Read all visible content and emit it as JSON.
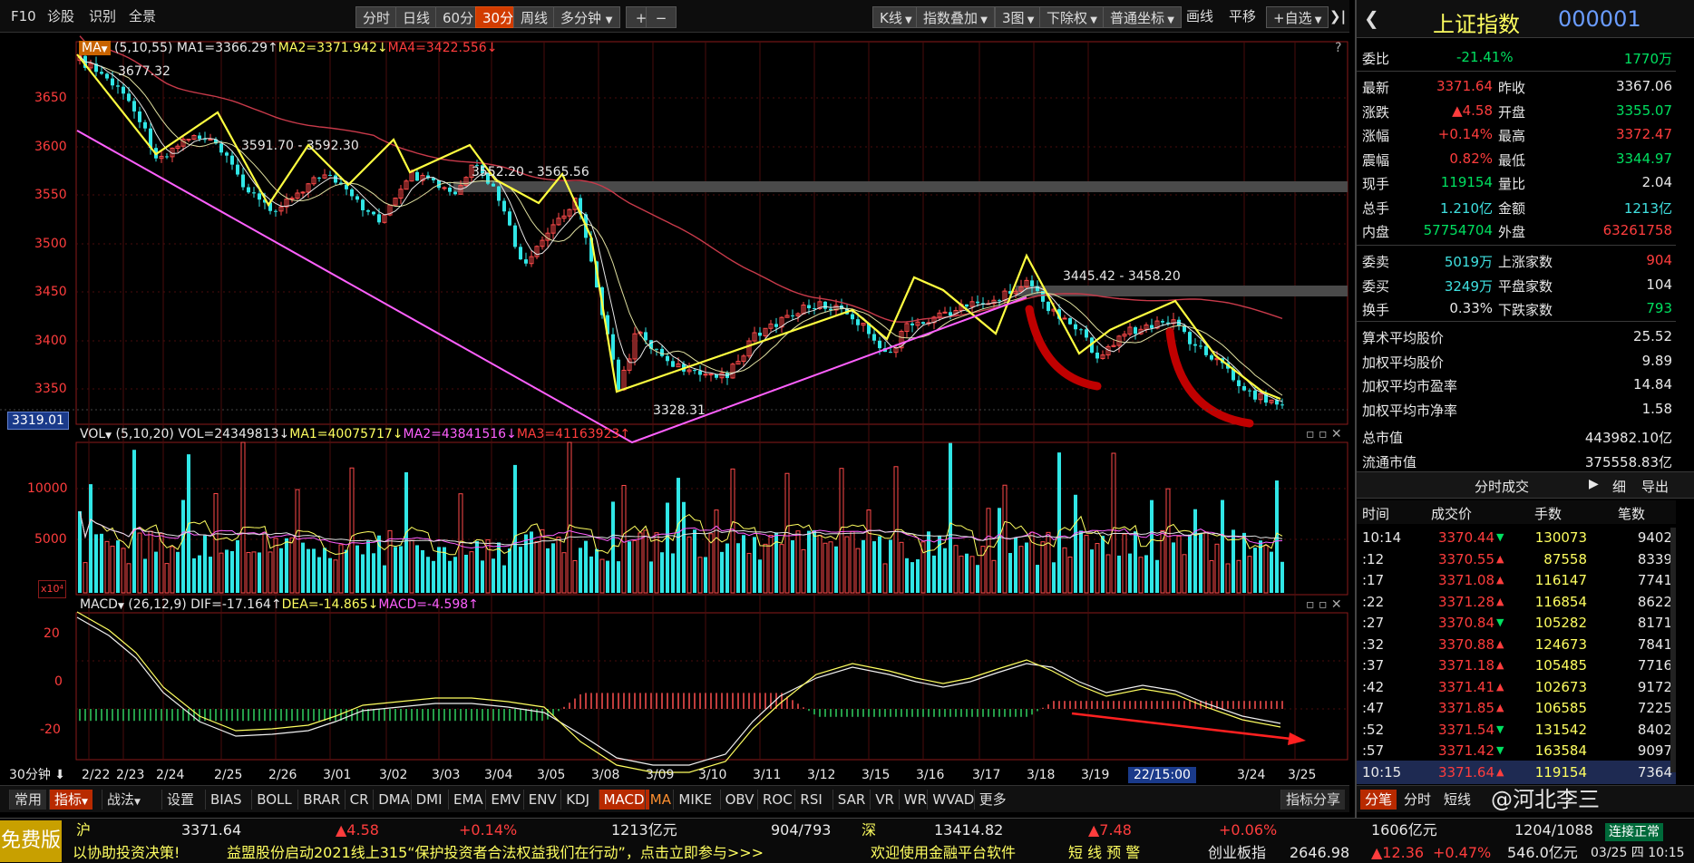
{
  "toolbar": {
    "left_items": [
      "F10",
      "诊股",
      "识别",
      "全景"
    ],
    "periods": [
      "分时",
      "日线",
      "60分",
      "30分",
      "周线"
    ],
    "multi": "多分钟",
    "plus": "+",
    "minus": "−",
    "right": [
      "K线",
      "指数叠加",
      "3图",
      "下除权",
      "普通坐标"
    ],
    "draw": "画线",
    "pan": "平移",
    "watch": "+自选",
    "expand": "❯|"
  },
  "main_panel": {
    "indicator": "MA",
    "params": "(5,10,55)",
    "ma1": "MA1=3366.29↑",
    "ma2": "MA2=3371.942↓",
    "ma4": "MA4=3422.556↓",
    "y_labels": [
      "3650",
      "3600",
      "3550",
      "3500",
      "3450",
      "3400",
      "3350"
    ],
    "cursor_price": "3319.01",
    "annotations": [
      "3677.32",
      "3591.70 - 3592.30",
      "3552.20 - 3565.56",
      "3445.42 - 3458.20",
      "3328.31"
    ],
    "help": "?"
  },
  "vol_panel": {
    "indicator": "VOL",
    "params": "(5,10,20)",
    "vol": "VOL=24349813↓",
    "ma1": "MA1=40075717↓",
    "ma2": "MA2=43841516↓",
    "ma3": "MA3=41163923↑",
    "y_labels": [
      "10000",
      "5000"
    ],
    "unit": "x10⁴"
  },
  "macd_panel": {
    "indicator": "MACD",
    "params": "(26,12,9)",
    "dif": "DIF=-17.164↑",
    "dea": "DEA=-14.865↓",
    "macd": "MACD=-4.598↑",
    "y_labels": [
      "20",
      "0",
      "-20"
    ]
  },
  "x_axis": {
    "period_label": "30分钟",
    "dates": [
      "2/22",
      "2/23",
      "2/24",
      "2/25",
      "2/26",
      "3/01",
      "3/02",
      "3/03",
      "3/04",
      "3/05",
      "3/08",
      "3/09",
      "3/10",
      "3/11",
      "3/12",
      "3/15",
      "3/16",
      "3/17",
      "3/18",
      "3/19",
      "3/24",
      "3/25"
    ],
    "cursor_time": "22/15:00"
  },
  "bottom_tabs": {
    "left": [
      "常用",
      "指标",
      "战法",
      "设置"
    ],
    "indicators": [
      "BIAS",
      "BOLL",
      "BRAR",
      "CR",
      "DMA",
      "DMI",
      "EMA",
      "EMV",
      "ENV",
      "KDJ",
      "MACD",
      "MA",
      "MIKE",
      "OBV",
      "ROC",
      "RSI",
      "SAR",
      "VR",
      "WR",
      "WVAD",
      "更多"
    ],
    "share": "指标分享"
  },
  "right_panel": {
    "name": "上证指数",
    "code": "000001",
    "webi": {
      "label": "委比",
      "pct": "-21.41%",
      "value": "1770万"
    },
    "quotes": [
      {
        "l1": "最新",
        "v1": "3371.64",
        "l2": "昨收",
        "v2": "3367.06"
      },
      {
        "l1": "涨跌",
        "v1": "▲4.58",
        "l2": "开盘",
        "v2": "3355.07"
      },
      {
        "l1": "涨幅",
        "v1": "+0.14%",
        "l2": "最高",
        "v2": "3372.47"
      },
      {
        "l1": "震幅",
        "v1": "0.82%",
        "l2": "最低",
        "v2": "3344.97"
      },
      {
        "l1": "现手",
        "v1": "119154",
        "l2": "量比",
        "v2": "2.04"
      },
      {
        "l1": "总手",
        "v1": "1.210亿",
        "l2": "金额",
        "v2": "1213亿"
      },
      {
        "l1": "内盘",
        "v1": "57754704",
        "l2": "外盘",
        "v2": "63261758"
      }
    ],
    "orders": [
      {
        "l1": "委卖",
        "v1": "5019万",
        "l2": "上涨家数",
        "v2": "904"
      },
      {
        "l1": "委买",
        "v1": "3249万",
        "l2": "平盘家数",
        "v2": "104"
      },
      {
        "l1": "换手",
        "v1": "0.33%",
        "l2": "下跌家数",
        "v2": "793"
      }
    ],
    "stats": [
      {
        "l": "算术平均股价",
        "v": "25.52"
      },
      {
        "l": "加权平均股价",
        "v": "9.89"
      },
      {
        "l": "加权平均市盈率",
        "v": "14.84"
      },
      {
        "l": "加权平均市净率",
        "v": "1.58"
      },
      {
        "l": "总市值",
        "v": "443982.10亿"
      },
      {
        "l": "流通市值",
        "v": "375558.83亿"
      }
    ],
    "ticks_title": "分时成交",
    "ticks_play": "▶",
    "ticks_detail": "细",
    "ticks_export": "导出",
    "ticks_headers": [
      "时间",
      "成交价",
      "手数",
      "笔数"
    ],
    "ticks": [
      {
        "t": "10:14",
        "p": "3370.44",
        "d": "▼",
        "v": "130073",
        "n": "9402"
      },
      {
        "t": ":12",
        "p": "3370.55",
        "d": "▲",
        "v": "87558",
        "n": "8339"
      },
      {
        "t": ":17",
        "p": "3371.08",
        "d": "▲",
        "v": "116147",
        "n": "7741"
      },
      {
        "t": ":22",
        "p": "3371.28",
        "d": "▲",
        "v": "116854",
        "n": "8622"
      },
      {
        "t": ":27",
        "p": "3370.84",
        "d": "▼",
        "v": "105282",
        "n": "8171"
      },
      {
        "t": ":32",
        "p": "3370.88",
        "d": "▲",
        "v": "124673",
        "n": "7841"
      },
      {
        "t": ":37",
        "p": "3371.18",
        "d": "▲",
        "v": "105485",
        "n": "7716"
      },
      {
        "t": ":42",
        "p": "3371.41",
        "d": "▲",
        "v": "102673",
        "n": "9172"
      },
      {
        "t": ":47",
        "p": "3371.85",
        "d": "▲",
        "v": "106585",
        "n": "7225"
      },
      {
        "t": ":52",
        "p": "3371.54",
        "d": "▼",
        "v": "131542",
        "n": "8402"
      },
      {
        "t": ":57",
        "p": "3371.42",
        "d": "▼",
        "v": "163584",
        "n": "9097"
      },
      {
        "t": "10:15",
        "p": "3371.64",
        "d": "▲",
        "v": "119154",
        "n": "7364"
      }
    ],
    "bottom_tabs": [
      "分笔",
      "分时",
      "短线"
    ],
    "watermark": "@河北李三"
  },
  "ticker": {
    "left_label": "免费版",
    "sh_label": "沪",
    "sh_price": "3371.64",
    "sh_chg": "▲4.58",
    "sh_pct": "+0.14%",
    "sh_amt": "1213亿元",
    "sh_ud": "904/793",
    "sz_label": "深",
    "sz_price": "13414.82",
    "sz_chg": "▲7.48",
    "sz_pct": "+0.06%",
    "sz_amt": "1606亿元",
    "sz_ud": "1204/1088",
    "status": "连接正常",
    "news1": "以协助投资决策!",
    "news2": "益盟股份启动2021线上315“保护投资者合法权益我们在行动”，点击立即参与>>>",
    "news3": "欢迎使用金融平台软件",
    "news4": "短 线 预 警",
    "news5": "创业板指",
    "cy_price": "2646.98",
    "cy_chg": "▲12.36",
    "cy_pct": "+0.47%",
    "cy_amt": "546.0亿元",
    "datetime": "03/25 四  10:15"
  }
}
